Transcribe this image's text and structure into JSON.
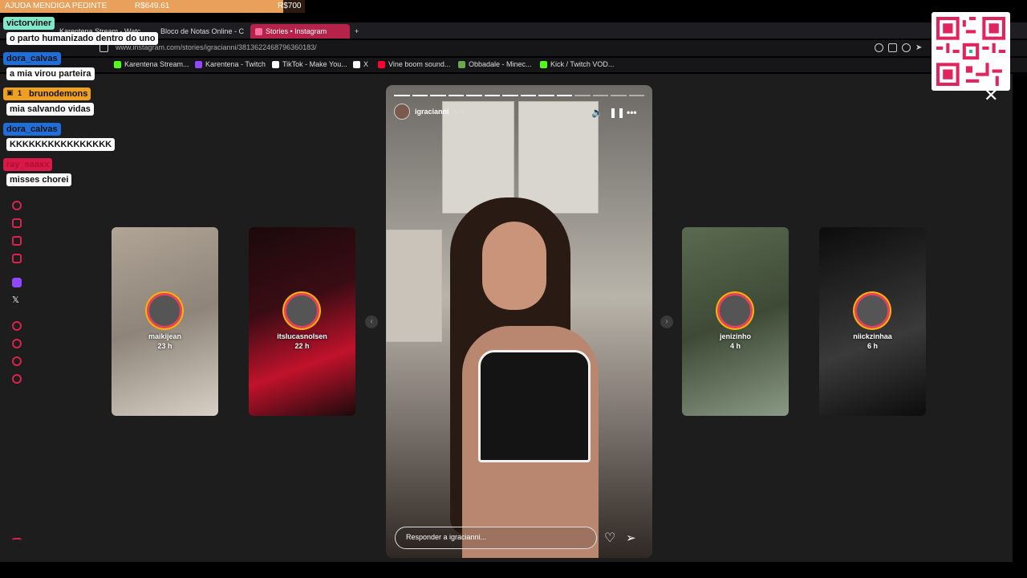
{
  "goal": {
    "title": "AJUDA MENDIGA PEDINTE",
    "current": "R$649.61",
    "target": "R$700",
    "progress_fraction": 0.928
  },
  "browser": {
    "tabs": [
      {
        "label": "Karentena Stream - Watc",
        "active": false
      },
      {
        "label": "Bloco de Notas Online - C",
        "active": false
      },
      {
        "label": "Stories • Instagram",
        "active": true
      }
    ],
    "new_tab_label": "+",
    "url": "www.instagram.com/stories/igracianni/3813622468796360183/",
    "bookmarks": [
      {
        "label": "Karentena Stream...",
        "color": "#53fc18"
      },
      {
        "label": "Karentena - Twitch",
        "color": "#9146ff"
      },
      {
        "label": "TikTok - Make You...",
        "color": "#ffffff"
      },
      {
        "label": "X",
        "color": "#ffffff"
      },
      {
        "label": "Vine boom sound...",
        "color": "#ff0033"
      },
      {
        "label": "Obbadale - Minec...",
        "color": "#6aa84f"
      },
      {
        "label": "Kick / Twitch VOD...",
        "color": "#53fc18"
      }
    ]
  },
  "chat": [
    {
      "user": "victorviner",
      "color": "#7ee8c8",
      "text_color": "#111",
      "message": "o parto humanizado dentro do uno"
    },
    {
      "user": "dora_calvas",
      "color": "#1e6fd9",
      "text_color": "#111",
      "message": "a mia virou parteira"
    },
    {
      "user": "brunodemons",
      "color": "#f0a020",
      "text_color": "#111",
      "badge": "1",
      "message": "mia salvando vidas"
    },
    {
      "user": "dora_calvas",
      "color": "#1e6fd9",
      "text_color": "#111",
      "message": "KKKKKKKKKKKKKKKK"
    },
    {
      "user": "ray_saaxx",
      "color": "#d8194a",
      "text_color": "#b0102e",
      "message": "misses chorei"
    }
  ],
  "stories": {
    "left": [
      {
        "user": "maikijean",
        "age": "23 h",
        "bg": "#9a8f84"
      },
      {
        "user": "itslucasnolsen",
        "age": "22 h",
        "bg": "#2a0c10"
      }
    ],
    "right": [
      {
        "user": "jenizinho",
        "age": "4 h",
        "bg": "#4c5a44"
      },
      {
        "user": "niickzinhaa",
        "age": "6 h",
        "bg": "#1a1a1a"
      }
    ],
    "main": {
      "user": "igracianni",
      "time": "5 h",
      "segments_total": 14,
      "segments_done": 10,
      "reply_placeholder": "Responder a igracianni...",
      "icons": {
        "mute": "speaker-icon",
        "pause": "pause-icon",
        "more": "more-icon",
        "like": "heart-icon",
        "share": "send-icon"
      }
    }
  }
}
